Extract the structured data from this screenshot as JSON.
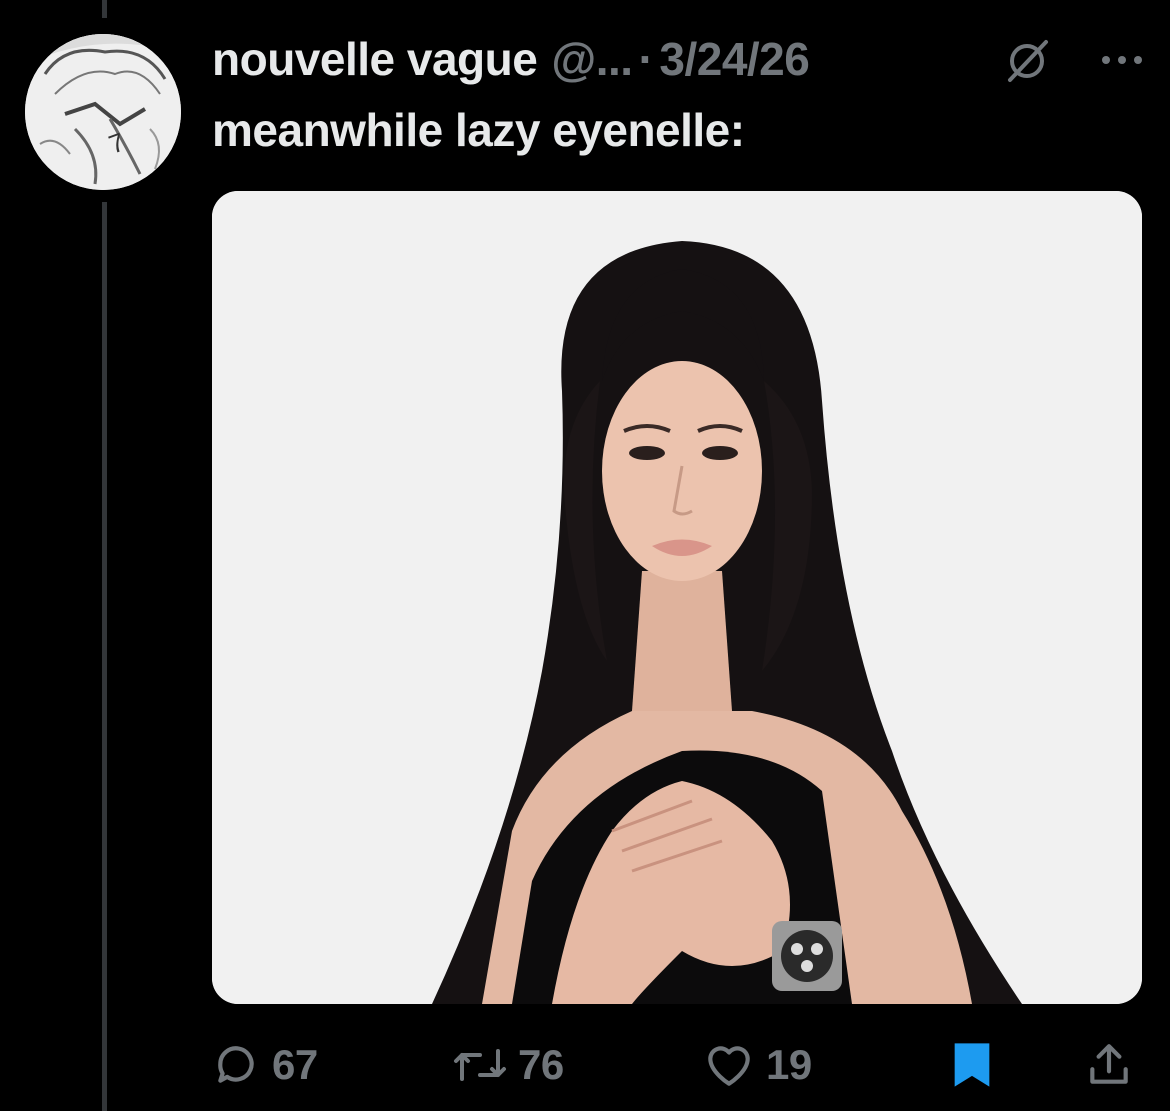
{
  "tweet": {
    "display_name": "nouvelle vague",
    "handle": "@...",
    "separator": "·",
    "date": "3/24/26",
    "text": "meanwhile lazy eyenelle:",
    "avatar_icon": "manga-avatar-icon",
    "grok_icon": "grok-icon",
    "more_icon": "more-dots-icon",
    "media": {
      "description_icon": "photo-woman-black-dress-icon",
      "background": "#f1f1f1"
    }
  },
  "actions": {
    "reply": {
      "icon": "reply-icon",
      "count": "67"
    },
    "repost": {
      "icon": "repost-icon",
      "count": "76"
    },
    "like": {
      "icon": "heart-icon",
      "count": "19"
    },
    "bookmark": {
      "icon": "bookmark-icon",
      "active": true,
      "color": "#1d9bf0"
    },
    "share": {
      "icon": "share-icon"
    }
  },
  "colors": {
    "background": "#000000",
    "text": "#e7e9ea",
    "muted": "#71767b",
    "accent": "#1d9bf0"
  }
}
